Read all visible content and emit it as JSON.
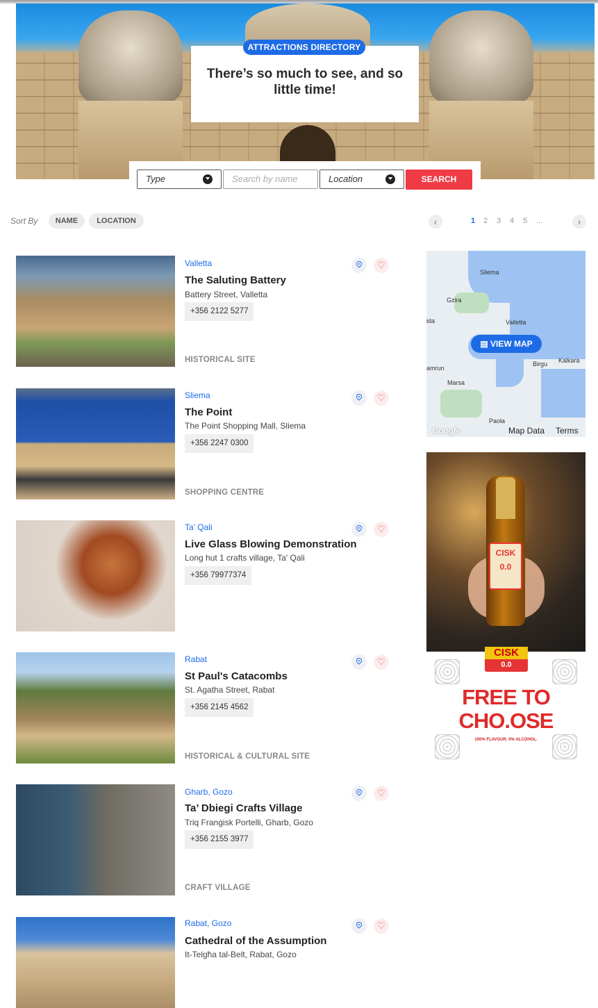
{
  "hero": {
    "badge": "ATTRACTIONS DIRECTORY",
    "title": "There’s so much to see, and so little time!"
  },
  "search": {
    "type_label": "Type",
    "name_placeholder": "Search by name",
    "location_label": "Location",
    "button": "SEARCH"
  },
  "sort": {
    "label": "Sort By",
    "options": [
      "NAME",
      "LOCATION"
    ]
  },
  "pagination": {
    "pages": [
      "1",
      "2",
      "3",
      "4",
      "5",
      "..."
    ],
    "current": "1",
    "prev": "‹",
    "next": "›"
  },
  "listings": [
    {
      "location": "Valletta",
      "name": "The Saluting Battery",
      "address": "Battery Street, Valletta",
      "phone": "+356 2122 5277",
      "category": "HISTORICAL SITE"
    },
    {
      "location": "Sliema",
      "name": "The Point",
      "address": "The Point Shopping Mall, Sliema",
      "phone": "+356 2247 0300",
      "category": "SHOPPING CENTRE"
    },
    {
      "location": "Ta' Qali",
      "name": "Live Glass Blowing Demonstration",
      "address": "Long hut 1 crafts village, Ta' Qali",
      "phone": "+356 79977374",
      "category": ""
    },
    {
      "location": "Rabat",
      "name": "St Paul's Catacombs",
      "address": "St. Agatha Street, Rabat",
      "phone": "+356 2145 4562",
      "category": "HISTORICAL & CULTURAL SITE"
    },
    {
      "location": "Gharb, Gozo",
      "name": "Ta’ Dbiegi Crafts Village",
      "address": "Triq Franġisk Portelli, Gharb, Gozo",
      "phone": "+356 2155 3977",
      "category": "CRAFT VILLAGE"
    },
    {
      "location": "Rabat, Gozo",
      "name": "Cathedral of the Assumption",
      "address": "It-Telgħa tal-Belt, Rabat, Gozo",
      "phone": "",
      "category": ""
    }
  ],
  "map": {
    "button": "VIEW MAP",
    "labels": [
      "Sliema",
      "Gzira",
      "Valletta",
      "Birgu",
      "Kalkara",
      "Marsa",
      "Paola",
      "ida",
      "amrun"
    ],
    "google": "Google",
    "map_data": "Map Data",
    "terms": "Terms"
  },
  "ad": {
    "brand": "CISK",
    "brand_sub": "0.0",
    "headline_1": "FREE TO",
    "headline_2": "CHO.OSE",
    "tagline": "100% FLAVOUR. 0% ALCOHOL."
  },
  "colors": {
    "accent": "#1e6be6",
    "search_button": "#ef3b45"
  }
}
